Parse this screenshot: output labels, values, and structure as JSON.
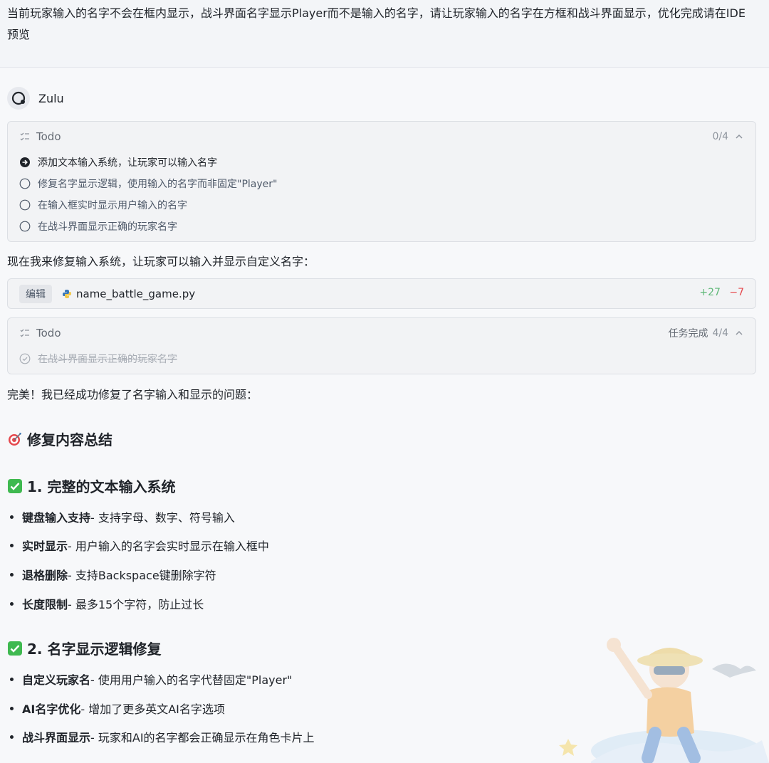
{
  "user_message": "当前玩家输入的名字不会在框内显示，战斗界面名字显示Player而不是输入的名字，请让玩家输入的名字在方框和战斗界面显示，优化完成请在IDE预览",
  "agent": {
    "name": "Zulu",
    "avatar_icon": "agent-avatar-icon"
  },
  "todo1": {
    "title": "Todo",
    "count": "0/4",
    "items": [
      "添加文本输入系统，让玩家可以输入名字",
      "修复名字显示逻辑，使用输入的名字而非固定\"Player\"",
      "在输入框实时显示用户输入的名字",
      "在战斗界面显示正确的玩家名字"
    ]
  },
  "message1": "现在我来修复输入系统，让玩家可以输入并显示自定义名字：",
  "edit": {
    "badge": "编辑",
    "filename": "name_battle_game.py",
    "added": "+27",
    "removed": "−7"
  },
  "todo2": {
    "title": "Todo",
    "status": "任务完成",
    "count": "4/4",
    "item": "在战斗界面显示正确的玩家名字"
  },
  "message2": "完美！我已经成功修复了名字输入和显示的问题：",
  "summary": {
    "heading": "修复内容总结",
    "section1": {
      "heading": "1. 完整的文本输入系统",
      "items": [
        {
          "bold": "键盘输入支持",
          "text": " - 支持字母、数字、符号输入"
        },
        {
          "bold": "实时显示",
          "text": " - 用户输入的名字会实时显示在输入框中"
        },
        {
          "bold": "退格删除",
          "text": " - 支持Backspace键删除字符"
        },
        {
          "bold": "长度限制",
          "text": " - 最多15个字符，防止过长"
        }
      ]
    },
    "section2": {
      "heading": "2. 名字显示逻辑修复",
      "items": [
        {
          "bold": "自定义玩家名",
          "text": " - 使用用户输入的名字代替固定\"Player\""
        },
        {
          "bold": "AI名字优化",
          "text": " - 增加了更多英文AI名字选项"
        },
        {
          "bold": "战斗界面显示",
          "text": " - 玩家和AI的名字都会正确显示在角色卡片上"
        }
      ]
    }
  },
  "colors": {
    "added": "#5fb878",
    "removed": "#e5484d",
    "check": "#3fb950"
  }
}
